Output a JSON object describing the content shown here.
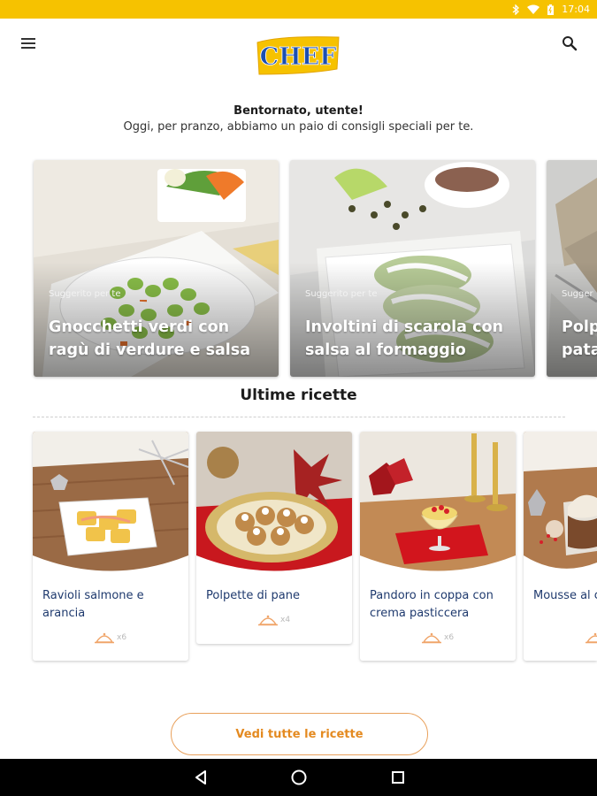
{
  "status_bar": {
    "time": "17:04",
    "icons": [
      "bluetooth-icon",
      "wifi-icon",
      "battery-icon"
    ],
    "color": "#f6c200"
  },
  "app_bar": {
    "logo_text": "CHEF",
    "menu_icon": "hamburger-menu-icon",
    "search_icon": "search-icon"
  },
  "welcome": {
    "title": "Bentornato, utente!",
    "subtitle": "Oggi, per pranzo, abbiamo un paio di consigli speciali per te."
  },
  "suggested": [
    {
      "tag": "Suggerito per te",
      "title_line1": "Gnocchetti verdi con",
      "title_line2": "ragù di verdure e salsa"
    },
    {
      "tag": "Suggerito per te",
      "title_line1": "Involtini di scarola con",
      "title_line2": "salsa al formaggio"
    },
    {
      "tag": "Sugger",
      "title_line1": "Polp",
      "title_line2": "pata"
    }
  ],
  "latest": {
    "title": "Ultime ricette",
    "recipes": [
      {
        "title": "Ravioli salmone e arancia",
        "serves": "x6"
      },
      {
        "title": "Polpette di pane",
        "serves": "x4"
      },
      {
        "title": "Pandoro in coppa con crema pasticcera",
        "serves": "x6"
      },
      {
        "title": "Mousse al c peperoncin",
        "serves": ""
      }
    ]
  },
  "all_recipes_button": "Vedi tutte le ricette",
  "colors": {
    "accent": "#e48a20",
    "brand_yellow": "#f6c200",
    "recipe_title": "#1f3a6e"
  }
}
